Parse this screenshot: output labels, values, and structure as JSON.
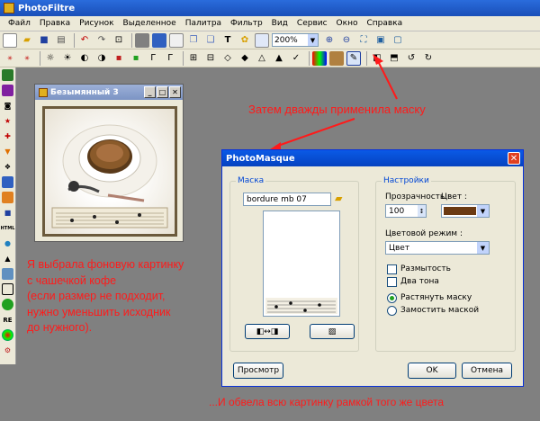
{
  "app": {
    "title": "PhotoFiltre"
  },
  "menu": [
    "Файл",
    "Правка",
    "Рисунок",
    "Выделенное",
    "Палитра",
    "Фильтр",
    "Вид",
    "Сервис",
    "Окно",
    "Справка"
  ],
  "toolbar": {
    "zoom": "200%"
  },
  "image_window": {
    "title": "Безымянный 3"
  },
  "dialog": {
    "title": "PhotoMasque",
    "mask_group": "Маска",
    "mask_file": "bordure mb 07",
    "settings_group": "Настройки",
    "transparency_label": "Прозрачность :",
    "transparency_value": "100",
    "color_label": "Цвет :",
    "color_value": "#6b3a12",
    "blend_mode_label": "Цветовой режим :",
    "blend_mode_value": "Цвет",
    "blur_label": "Размытость",
    "two_tone_label": "Два тона",
    "stretch_label": "Растянуть маску",
    "tile_label": "Замостить маской",
    "preview_button": "Просмотр",
    "ok_button": "OK",
    "cancel_button": "Отмена"
  },
  "annotations": {
    "top": "Затем дважды применила маску",
    "left": [
      "Я выбрала фоновую картинку",
      "с чашечкой кофе",
      "(если размер не подходит,",
      "нужно уменьшить исходник",
      "до нужного)."
    ],
    "bottom": "...И обвела всю картинку рамкой того же цвета"
  },
  "colors": {
    "accent": "#0a5ae6",
    "annotation": "#ff1a1a",
    "mask_color": "#6b3a12"
  }
}
